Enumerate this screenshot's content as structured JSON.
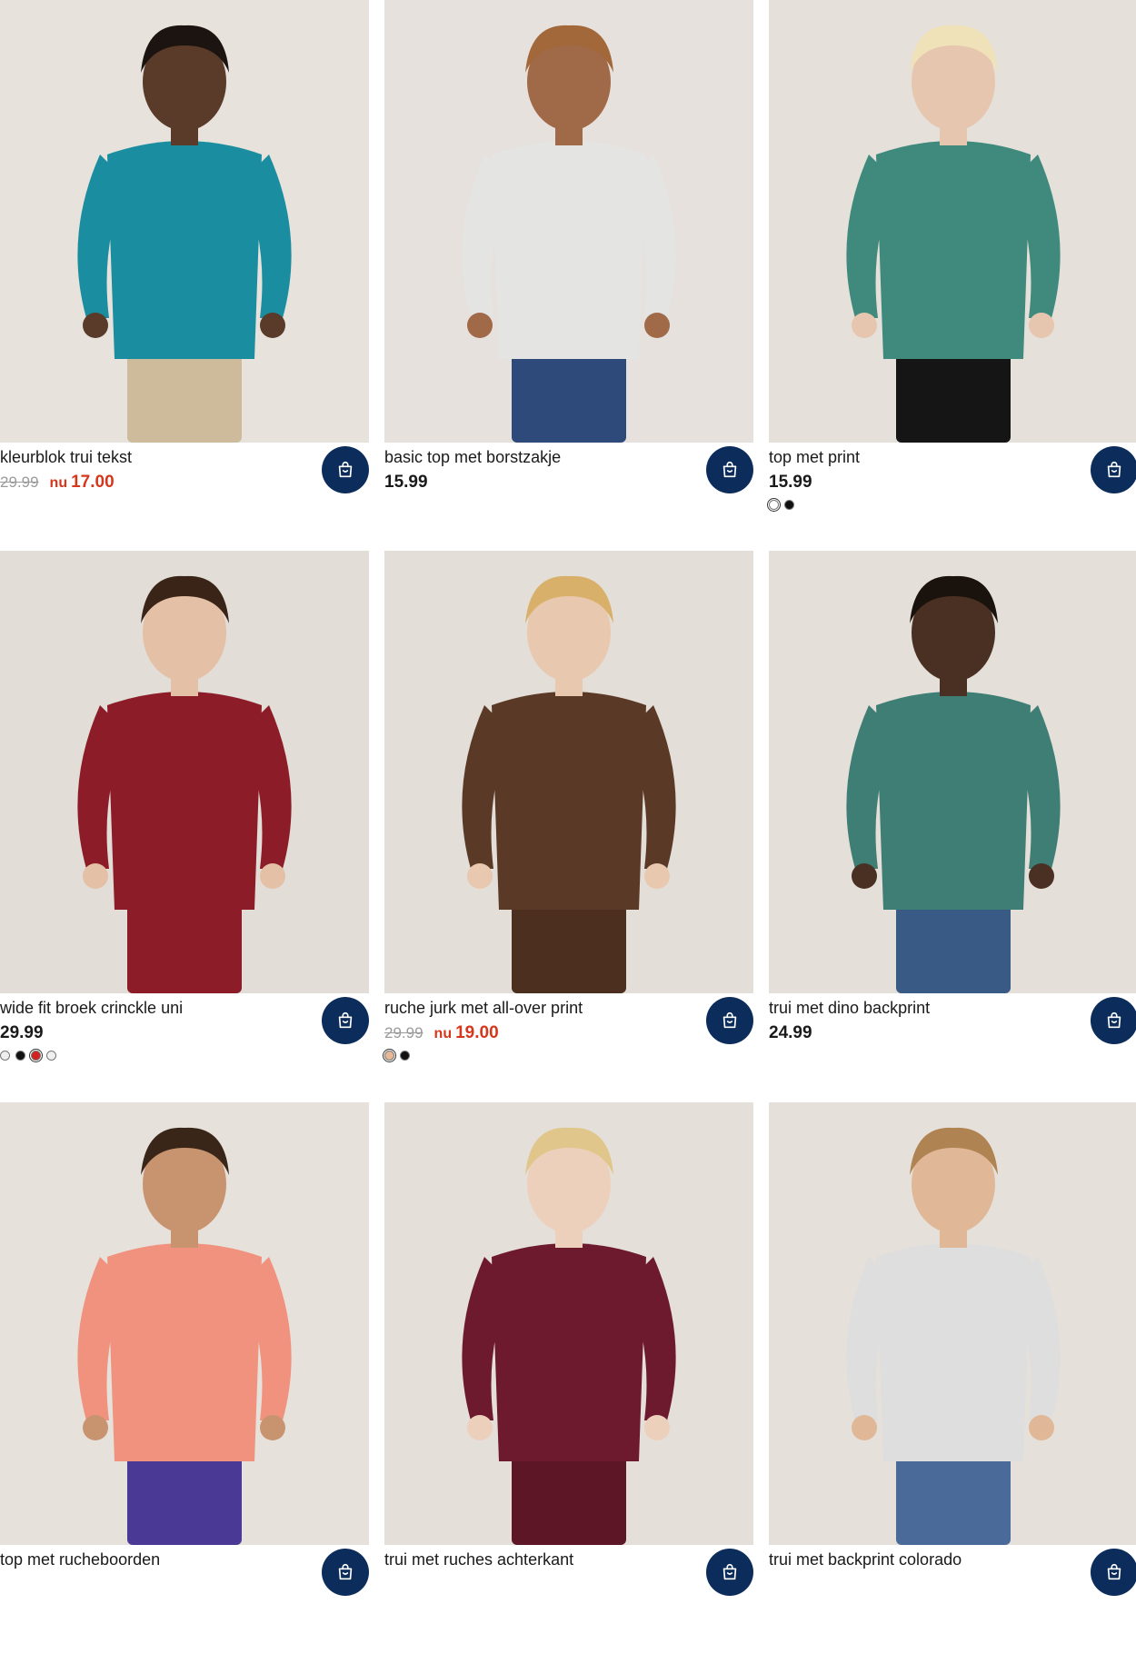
{
  "products": [
    {
      "title": "kleurblok trui tekst",
      "old_price": "29.99",
      "now_label": "nu",
      "sale_price": "17.00",
      "price": "",
      "swatches": [],
      "bg": "#e7e2dc",
      "top": "#1a8ea0",
      "bottom": "#cdbb9c",
      "skin": "#5a3a28",
      "hair": "#1c1410"
    },
    {
      "title": "basic top met borstzakje",
      "old_price": "",
      "now_label": "",
      "sale_price": "",
      "price": "15.99",
      "swatches": [],
      "bg": "#e6e1dc",
      "top": "#e4e4e2",
      "bottom": "#2e4a7a",
      "skin": "#a06a48",
      "hair": "#a2683a"
    },
    {
      "title": "top met print",
      "old_price": "",
      "now_label": "",
      "sale_price": "",
      "price": "15.99",
      "swatches": [
        "#ffffff",
        "#111111"
      ],
      "bg": "#e5e0da",
      "top": "#3f8a7c",
      "bottom": "#151515",
      "skin": "#e6c6ae",
      "hair": "#f0e2b8"
    },
    {
      "title": "wide fit broek crinckle uni",
      "old_price": "",
      "now_label": "",
      "sale_price": "",
      "price": "29.99",
      "swatches": [
        "#eeeeee",
        "#111111",
        "#d32020",
        "#f0f0f0"
      ],
      "bg": "#e2ddd7",
      "top": "#8c1c28",
      "bottom": "#8c1c28",
      "skin": "#e4c0a6",
      "hair": "#3a2418"
    },
    {
      "title": "ruche jurk met all-over print",
      "old_price": "29.99",
      "now_label": "nu",
      "sale_price": "19.00",
      "price": "",
      "swatches": [
        "#e8b896",
        "#111111"
      ],
      "bg": "#e3ded8",
      "top": "#5a3a26",
      "bottom": "#4c2f1e",
      "skin": "#e8c8ae",
      "hair": "#d9b06a"
    },
    {
      "title": "trui met dino backprint",
      "old_price": "",
      "now_label": "",
      "sale_price": "",
      "price": "24.99",
      "swatches": [],
      "bg": "#e4dfd9",
      "top": "#3f7e74",
      "bottom": "#3a5a86",
      "skin": "#4a3022",
      "hair": "#1a120c"
    },
    {
      "title": "top met rucheboorden",
      "old_price": "",
      "now_label": "",
      "sale_price": "",
      "price": "",
      "swatches": [],
      "bg": "#e6e1db",
      "top": "#f0927e",
      "bottom": "#4a3a96",
      "skin": "#c89470",
      "hair": "#3a2618"
    },
    {
      "title": "trui met ruches achterkant",
      "old_price": "",
      "now_label": "",
      "sale_price": "",
      "price": "",
      "swatches": [],
      "bg": "#e4dfd9",
      "top": "#6e1a2e",
      "bottom": "#5c1626",
      "skin": "#ecd0bc",
      "hair": "#e0c68a"
    },
    {
      "title": "trui met backprint colorado",
      "old_price": "",
      "now_label": "",
      "sale_price": "",
      "price": "",
      "swatches": [],
      "bg": "#e5e0da",
      "top": "#dedede",
      "bottom": "#4a6a9a",
      "skin": "#e0b898",
      "hair": "#b08452"
    }
  ]
}
